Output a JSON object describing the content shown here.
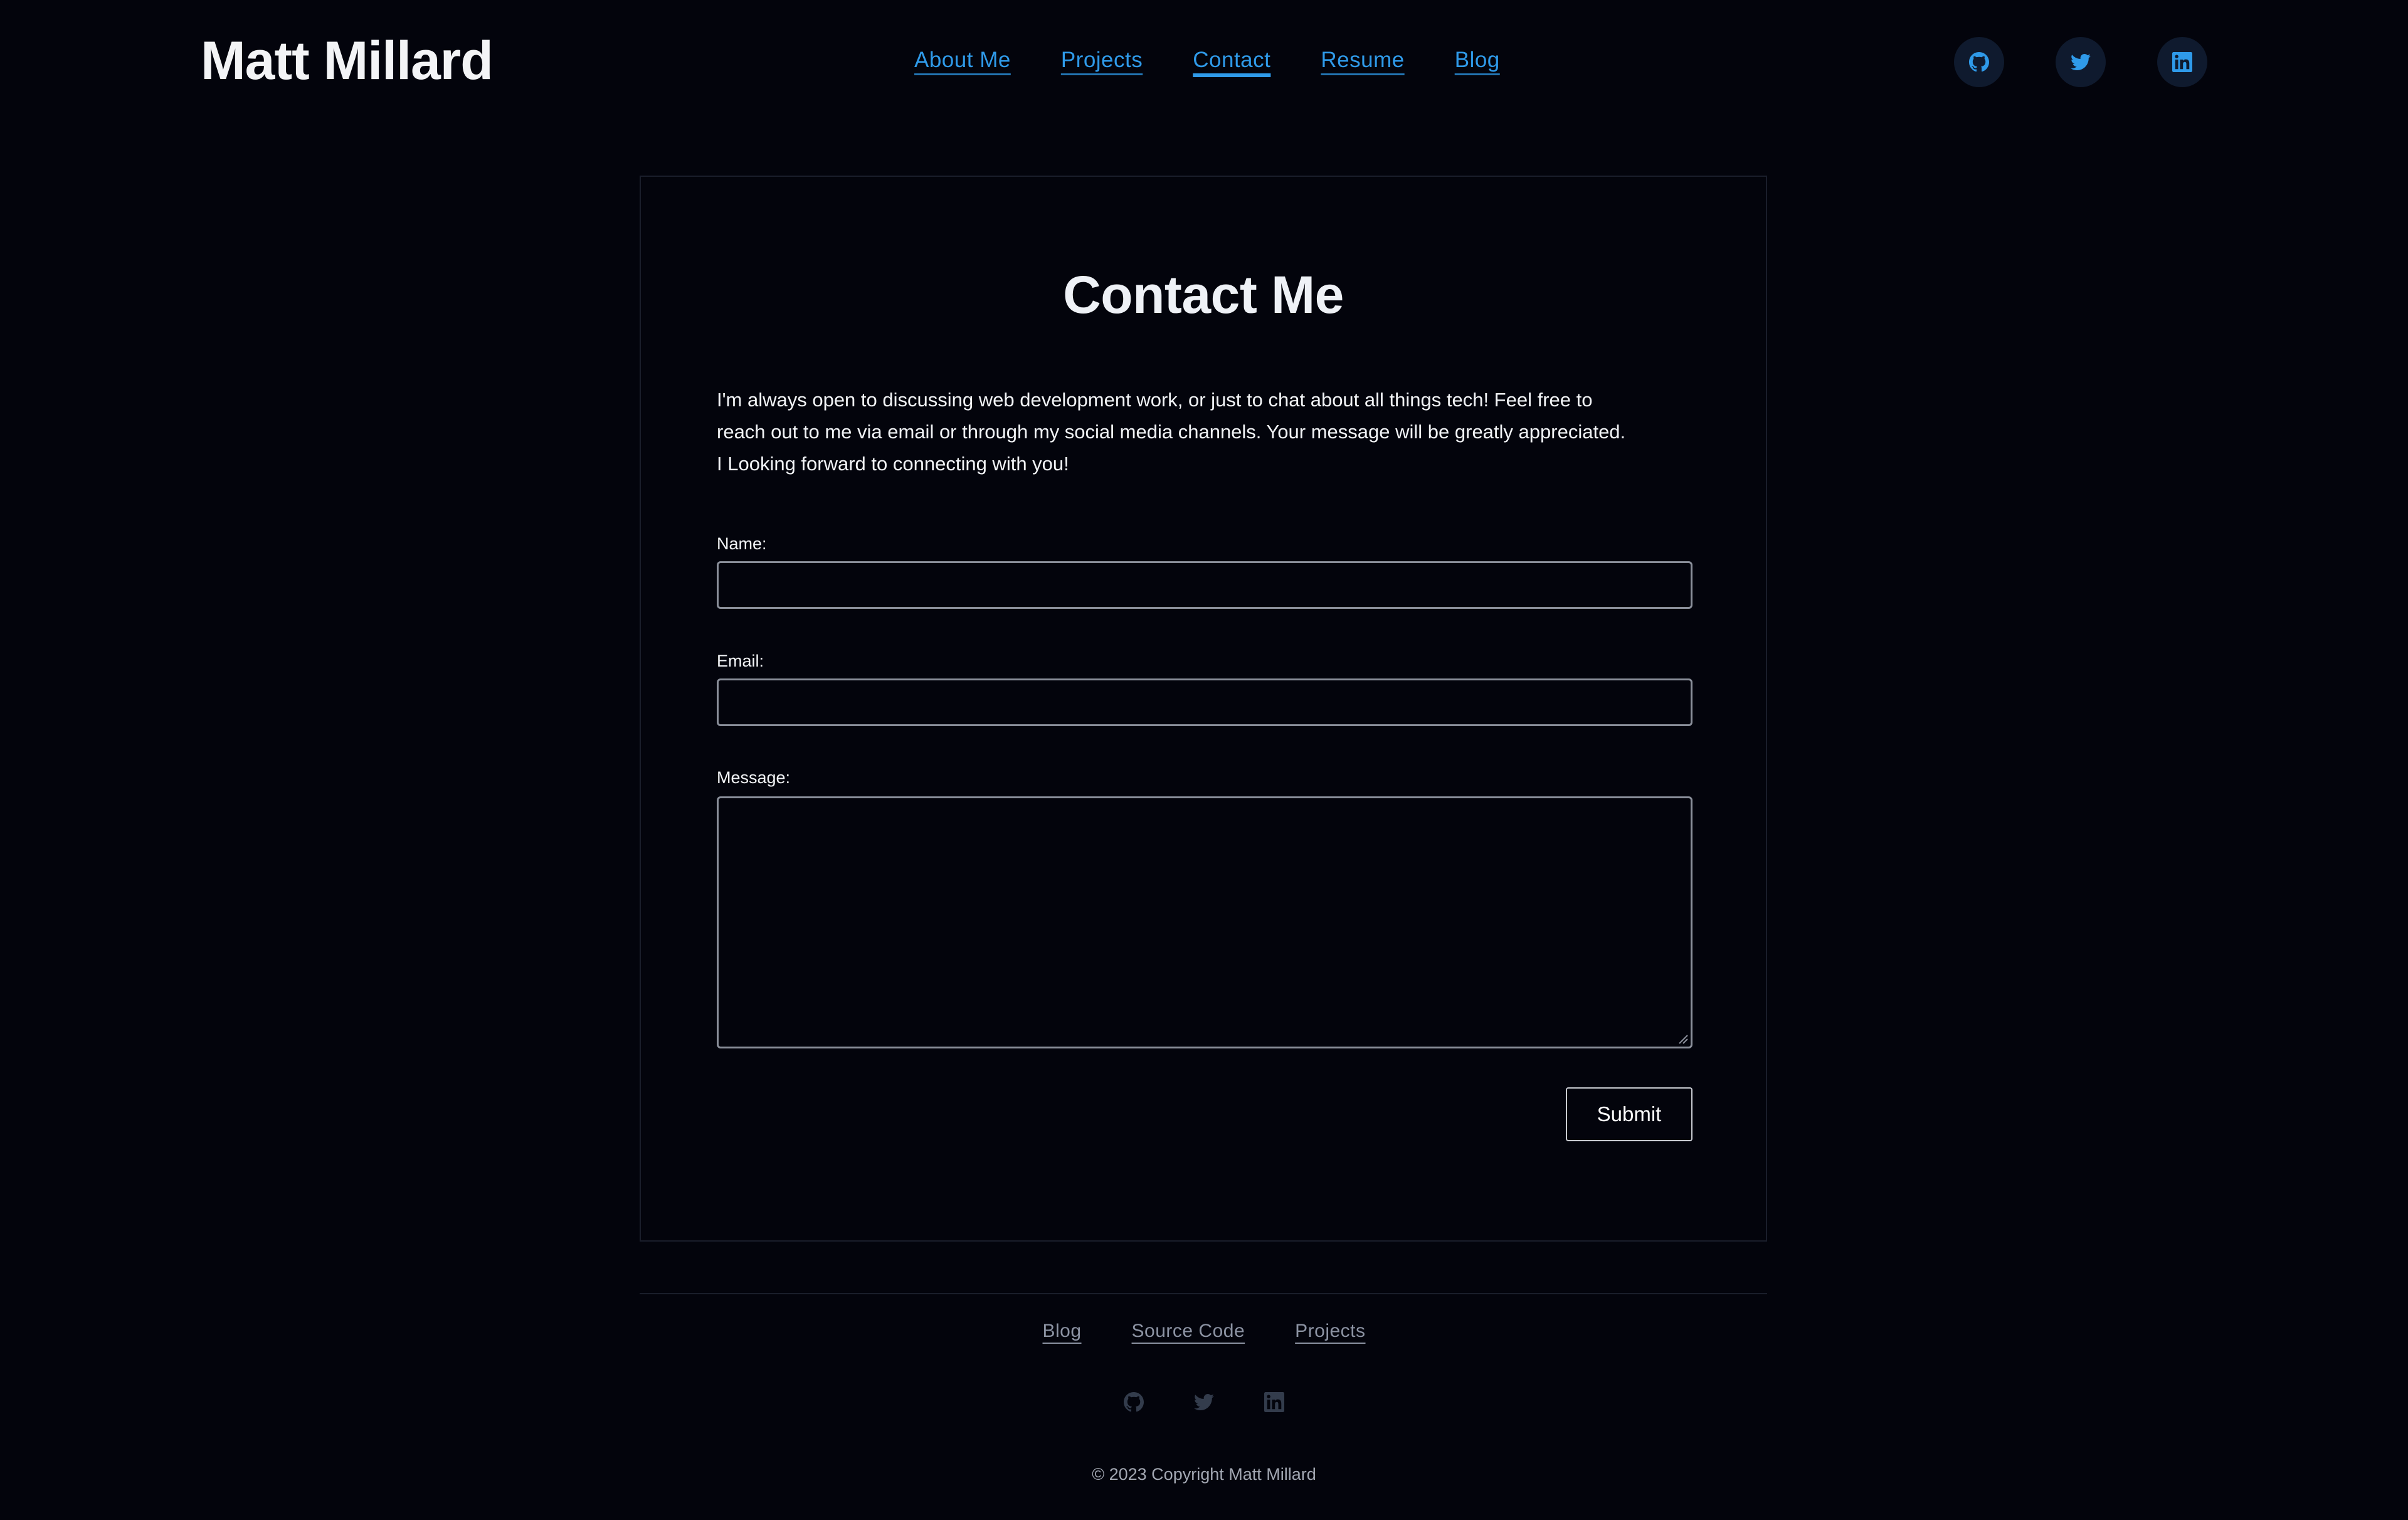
{
  "header": {
    "brand": "Matt Millard",
    "nav": [
      {
        "label": "About Me"
      },
      {
        "label": "Projects"
      },
      {
        "label": "Contact",
        "active": true
      },
      {
        "label": "Resume"
      },
      {
        "label": "Blog"
      }
    ],
    "social_icons": [
      "github-icon",
      "twitter-icon",
      "linkedin-icon"
    ]
  },
  "contact": {
    "title": "Contact Me",
    "intro": "I'm always open to discussing web development work, or just to chat about all things tech! Feel free to reach out to me via email or through my social media channels. Your message will be greatly appreciated. I Looking forward to connecting with you!",
    "form": {
      "name_label": "Name:",
      "name_value": "",
      "email_label": "Email:",
      "email_value": "",
      "message_label": "Message:",
      "message_value": "",
      "submit_label": "Submit"
    }
  },
  "footer": {
    "links": [
      {
        "label": "Blog"
      },
      {
        "label": "Source Code"
      },
      {
        "label": "Projects"
      }
    ],
    "social_icons": [
      "github-icon",
      "twitter-icon",
      "linkedin-icon"
    ],
    "copyright": "© 2023 Copyright Matt Millard"
  },
  "colors": {
    "background": "#03040c",
    "accent": "#2f9ae9",
    "text": "#f3f4f6",
    "muted": "#8c93a3"
  }
}
